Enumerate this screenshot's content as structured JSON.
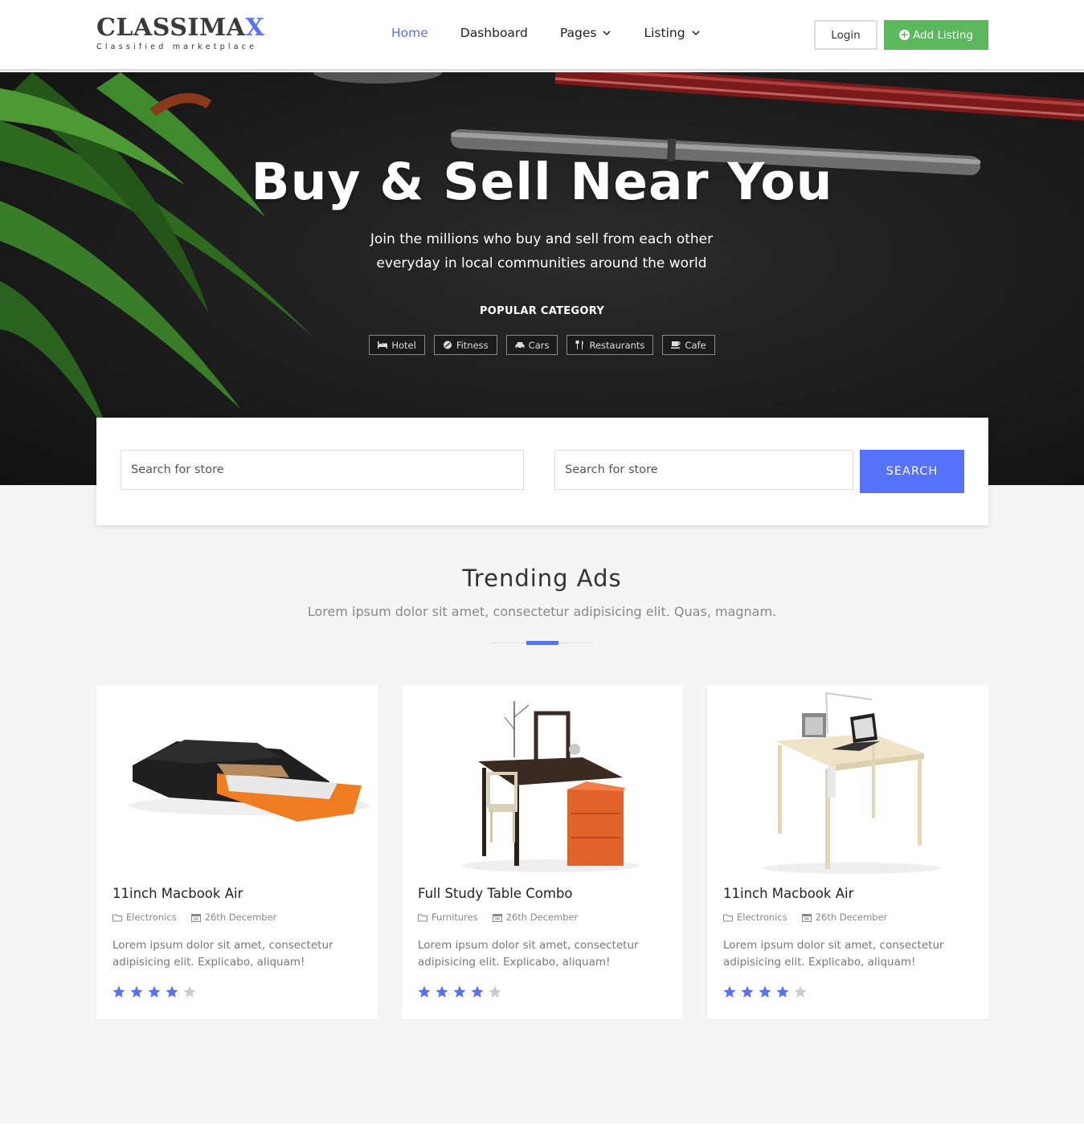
{
  "brand": {
    "name_main": "CLASSIMA",
    "name_accent": "X",
    "tagline": "Classified marketplace"
  },
  "nav": [
    {
      "label": "Home",
      "active": true,
      "dropdown": false
    },
    {
      "label": "Dashboard",
      "active": false,
      "dropdown": false
    },
    {
      "label": "Pages",
      "active": false,
      "dropdown": true
    },
    {
      "label": "Listing",
      "active": false,
      "dropdown": true
    }
  ],
  "header": {
    "login_label": "Login",
    "add_listing_label": "Add Listing"
  },
  "hero": {
    "title": "Buy & Sell Near You",
    "subtitle_line1": "Join the millions who buy and sell from each other",
    "subtitle_line2": "everyday in local communities around the world",
    "popular_label": "POPULAR CATEGORY",
    "categories": [
      {
        "label": "Hotel",
        "icon": "bed-icon"
      },
      {
        "label": "Fitness",
        "icon": "fitness-icon"
      },
      {
        "label": "Cars",
        "icon": "car-icon"
      },
      {
        "label": "Restaurants",
        "icon": "cutlery-icon"
      },
      {
        "label": "Cafe",
        "icon": "coffee-icon"
      }
    ]
  },
  "search": {
    "placeholder_1": "Search for store",
    "placeholder_2": "Search for store",
    "button_label": "SEARCH"
  },
  "trending": {
    "title": "Trending Ads",
    "subtitle": "Lorem ipsum dolor sit amet, consectetur adipisicing elit. Quas, magnam.",
    "cards": [
      {
        "title": "11inch Macbook Air",
        "category": "Electronics",
        "date": "26th December",
        "description": "Lorem ipsum dolor sit amet, consectetur adipisicing elit. Explicabo, aliquam!",
        "rating": 4
      },
      {
        "title": "Full Study Table Combo",
        "category": "Furnitures",
        "date": "26th December",
        "description": "Lorem ipsum dolor sit amet, consectetur adipisicing elit. Explicabo, aliquam!",
        "rating": 4
      },
      {
        "title": "11inch Macbook Air",
        "category": "Electronics",
        "date": "26th December",
        "description": "Lorem ipsum dolor sit amet, consectetur adipisicing elit. Explicabo, aliquam!",
        "rating": 4
      }
    ]
  },
  "colors": {
    "accent": "#5672f9",
    "success": "#5cb85c",
    "star_off": "#cccccc"
  }
}
